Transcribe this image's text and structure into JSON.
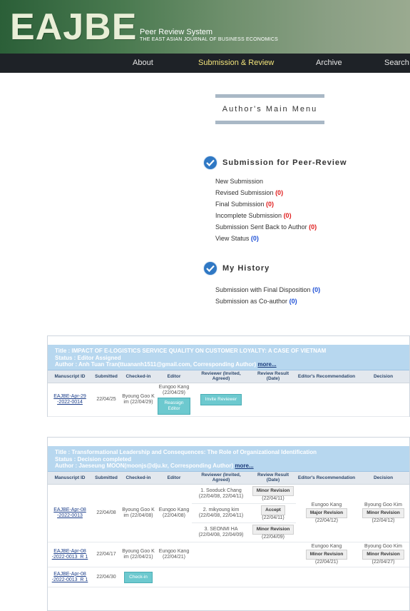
{
  "header": {
    "logo": "EAJBE",
    "subtitle": "Peer Review System",
    "journal": "THE EAST ASIAN JOURNAL OF BUSINESS ECONOMICS"
  },
  "nav": {
    "items": [
      "About",
      "Submission & Review",
      "Archive",
      "Search"
    ],
    "active": "Submission & Review"
  },
  "main_menu": {
    "title": "Author's Main Menu",
    "peer_review": {
      "heading": "Submission for Peer-Review",
      "items": [
        {
          "label": "New Submission",
          "count": ""
        },
        {
          "label": "Revised Submission",
          "count": "(0)"
        },
        {
          "label": "Final Submission",
          "count": "(0)"
        },
        {
          "label": "Incomplete Submission",
          "count": "(0)"
        },
        {
          "label": "Submission Sent Back to Author",
          "count": "(0)"
        },
        {
          "label": "View Status",
          "count": "(0)"
        }
      ]
    },
    "history": {
      "heading": "My History",
      "items": [
        {
          "label": "Submission with Final Disposition",
          "count": "(0)"
        },
        {
          "label": "Submission as Co-author",
          "count": "(0)"
        }
      ]
    }
  },
  "columns": [
    "Manuscript ID",
    "Submitted",
    "Checked-in",
    "Editor",
    "Reviewer (Invited, Agreed)",
    "Review Result (Date)",
    "Editor's Recommendation",
    "Decision"
  ],
  "manuscripts": [
    {
      "title": "Title : IMPACT OF E-LOGISTICS SERVICE QUALITY ON CUSTOMER LOYALTY: A CASE OF VIETNAM",
      "status": "Status : Editor Assigned",
      "author": "Author : Anh Tuan Tran(ttuananh1511@gmail.com, Corresponding Author)",
      "more": "more...",
      "row": {
        "id": "EAJBE-Apr-29 -2022-0014",
        "submitted": "22/04/25",
        "checked_in": "Byoung Goo K im (22/04/29)",
        "editor_name": "Eungoo Kang",
        "editor_date": "(22/04/29)",
        "reassign": "Reassign Editor",
        "invite": "Invite Reviewer"
      }
    },
    {
      "title": "Title : Transformational Leadership and Consequences: The Role of Organizational Identification",
      "status": "Status : Decision completed",
      "author": "Author : Jaeseung MOON(moonjs@dju.kr, Corresponding Author)",
      "more": "more...",
      "rows": [
        {
          "id": "EAJBE-Apr-08 -2022-0013",
          "submitted": "22/04/08",
          "checked_in": "Byoung Goo K im (22/04/08)",
          "editor": "Eungoo Kang (22/04/08)",
          "reviewers": [
            {
              "name": "1. Sooduck Chang",
              "dates": "(22/04/08, 22/04/11)",
              "result": "Minor Revision",
              "result_date": "(22/04/11)"
            },
            {
              "name": "2. mikyoung kim",
              "dates": "(22/04/08, 22/04/11)",
              "result": "Accept",
              "result_date": "(22/04/11)"
            },
            {
              "name": "3. SEONMI HA",
              "dates": "(22/04/08, 22/04/09)",
              "result": "Minor Revision",
              "result_date": "(22/04/09)"
            }
          ],
          "rec_name": "Eungoo Kang",
          "rec": "Major Revision",
          "rec_date": "(22/04/12)",
          "dec_name": "Byoung Goo Kim",
          "dec": "Minor Revision",
          "dec_date": "(22/04/12)"
        },
        {
          "id": "EAJBE-Apr-08 -2022-0013_R 1",
          "submitted": "22/04/17",
          "checked_in": "Byoung Goo K im (22/04/21)",
          "editor": "Eungoo Kang (22/04/21)",
          "rec_name": "Eungoo Kang",
          "rec": "Minor Revision",
          "rec_date": "(22/04/21)",
          "dec_name": "Byoung Goo Kim",
          "dec": "Minor Revision",
          "dec_date": "(22/04/27)"
        },
        {
          "id": "EAJBE-Apr-08 -2022-0013_R 1",
          "submitted": "22/04/30",
          "checkin_btn": "Check-in"
        }
      ]
    }
  ]
}
